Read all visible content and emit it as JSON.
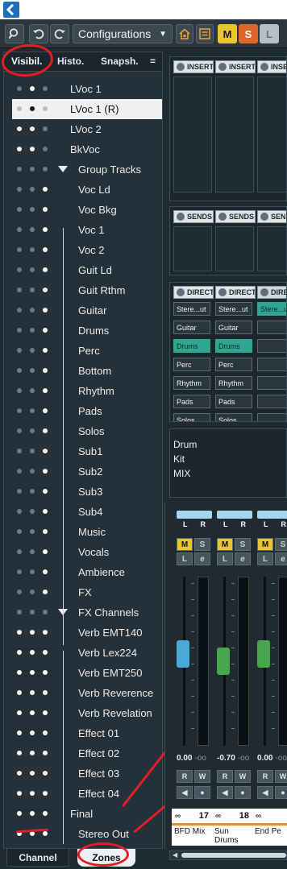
{
  "toolbar": {
    "configurations_label": "Configurations",
    "mute_label": "M",
    "solo_label": "S",
    "listen_label": "L"
  },
  "left_tabs": {
    "visibility": "Visibil.",
    "history": "Histo.",
    "snapshots": "Snapsh.",
    "menu": "="
  },
  "tracks": [
    {
      "label": "LVoc 1",
      "level": 0,
      "dots": [
        0,
        1,
        0
      ]
    },
    {
      "label": "LVoc 1 (R)",
      "level": 0,
      "dots": [
        0,
        1,
        0
      ],
      "selected": true
    },
    {
      "label": "LVoc 2",
      "level": 0,
      "dots": [
        1,
        1,
        0
      ]
    },
    {
      "label": "BkVoc",
      "level": 0,
      "dots": [
        1,
        1,
        0
      ]
    },
    {
      "label": "Group Tracks",
      "level": 1,
      "dots": [
        0,
        0,
        0
      ],
      "folder": true
    },
    {
      "label": "Voc Ld",
      "level": 1,
      "dots": [
        0,
        0,
        1
      ]
    },
    {
      "label": "Voc Bkg",
      "level": 1,
      "dots": [
        0,
        0,
        1
      ]
    },
    {
      "label": "Voc 1",
      "level": 1,
      "dots": [
        0,
        0,
        1
      ]
    },
    {
      "label": "Voc 2",
      "level": 1,
      "dots": [
        0,
        0,
        1
      ]
    },
    {
      "label": "Guit Ld",
      "level": 1,
      "dots": [
        0,
        0,
        1
      ]
    },
    {
      "label": "Guit Rthm",
      "level": 1,
      "dots": [
        0,
        0,
        1
      ]
    },
    {
      "label": "Guitar",
      "level": 1,
      "dots": [
        0,
        0,
        1
      ]
    },
    {
      "label": "Drums",
      "level": 1,
      "dots": [
        0,
        0,
        1
      ]
    },
    {
      "label": "Perc",
      "level": 1,
      "dots": [
        0,
        0,
        1
      ]
    },
    {
      "label": "Bottom",
      "level": 1,
      "dots": [
        0,
        0,
        1
      ]
    },
    {
      "label": "Rhythm",
      "level": 1,
      "dots": [
        0,
        0,
        1
      ]
    },
    {
      "label": "Pads",
      "level": 1,
      "dots": [
        0,
        0,
        1
      ]
    },
    {
      "label": "Solos",
      "level": 1,
      "dots": [
        0,
        0,
        1
      ]
    },
    {
      "label": "Sub1",
      "level": 1,
      "dots": [
        0,
        0,
        1
      ]
    },
    {
      "label": "Sub2",
      "level": 1,
      "dots": [
        0,
        0,
        1
      ]
    },
    {
      "label": "Sub3",
      "level": 1,
      "dots": [
        0,
        0,
        1
      ]
    },
    {
      "label": "Sub4",
      "level": 1,
      "dots": [
        0,
        0,
        1
      ]
    },
    {
      "label": "Music",
      "level": 1,
      "dots": [
        0,
        0,
        1
      ]
    },
    {
      "label": "Vocals",
      "level": 1,
      "dots": [
        0,
        0,
        1
      ]
    },
    {
      "label": "Ambience",
      "level": 1,
      "dots": [
        0,
        0,
        1
      ]
    },
    {
      "label": "FX",
      "level": 1,
      "dots": [
        0,
        0,
        1
      ]
    },
    {
      "label": "FX Channels",
      "level": 1,
      "dots": [
        0,
        0,
        0
      ],
      "folder": true
    },
    {
      "label": "Verb EMT140",
      "level": 1,
      "dots": [
        1,
        1,
        1
      ]
    },
    {
      "label": "Verb Lex224",
      "level": 1,
      "dots": [
        1,
        1,
        1
      ]
    },
    {
      "label": "Verb EMT250",
      "level": 1,
      "dots": [
        1,
        1,
        1
      ]
    },
    {
      "label": "Verb Reverence",
      "level": 1,
      "dots": [
        1,
        1,
        1
      ]
    },
    {
      "label": "Verb Revelation",
      "level": 1,
      "dots": [
        1,
        1,
        1
      ]
    },
    {
      "label": "Effect 01",
      "level": 1,
      "dots": [
        1,
        1,
        1
      ]
    },
    {
      "label": "Effect 02",
      "level": 1,
      "dots": [
        1,
        1,
        1
      ]
    },
    {
      "label": "Effect 03",
      "level": 1,
      "dots": [
        1,
        1,
        1
      ]
    },
    {
      "label": "Effect 04",
      "level": 1,
      "dots": [
        1,
        1,
        1
      ]
    },
    {
      "label": "Final",
      "level": 0,
      "dots": [
        1,
        1,
        1
      ]
    },
    {
      "label": "Stereo Out",
      "level": 1,
      "dots": [
        1,
        1,
        1
      ]
    }
  ],
  "bottom_tabs": {
    "channel": "Channel",
    "zones": "Zones"
  },
  "inserts_rack": {
    "headers": [
      "INSERT",
      "INSERT",
      "INSE"
    ]
  },
  "sends_rack": {
    "headers": [
      "SENDS",
      "SENDS",
      "SENI"
    ]
  },
  "routing_rack": {
    "headers": [
      "DIRECT",
      "DIRECT",
      "DIRE"
    ],
    "rows": [
      [
        "Stere...ut",
        "Stere...ut",
        "Stere...ut"
      ],
      [
        "Guitar",
        "Guitar",
        ""
      ],
      [
        "Drums",
        "Drums",
        ""
      ],
      [
        "Perc",
        "Perc",
        ""
      ],
      [
        "Rhythm",
        "Rhythm",
        ""
      ],
      [
        "Pads",
        "Pads",
        ""
      ],
      [
        "Solos",
        "Solos",
        ""
      ]
    ]
  },
  "notes": {
    "text": "Drum\nKit\nMIX"
  },
  "channels": [
    {
      "number": "17",
      "name": "BFD Mix",
      "volume": "0.00",
      "peak": "-oo",
      "fader_color": "#4aa9d6",
      "fader_level": 0.55,
      "meter_color": "#4aa9d6"
    },
    {
      "number": "18",
      "name": "Sun Drums",
      "volume": "-0.70",
      "peak": "-oo",
      "fader_color": "#4aa64c",
      "fader_level": 0.5,
      "meter_color": "#4aa64c"
    },
    {
      "number": "",
      "name": "End Pe",
      "volume": "0.00",
      "peak": "-oo",
      "fader_color": "#4aa64c",
      "fader_level": 0.55,
      "meter_color": "#4aa64c"
    }
  ],
  "strip_labels": {
    "left": "L",
    "right": "R",
    "mute": "M",
    "solo": "S",
    "listen": "L",
    "edit": "e",
    "read": "R",
    "write": "W"
  },
  "colors": {
    "accent_teal": "#30a592",
    "mute_yellow": "#e8c535",
    "solo_orange": "#e0652d",
    "annotation_red": "#e31d23"
  }
}
